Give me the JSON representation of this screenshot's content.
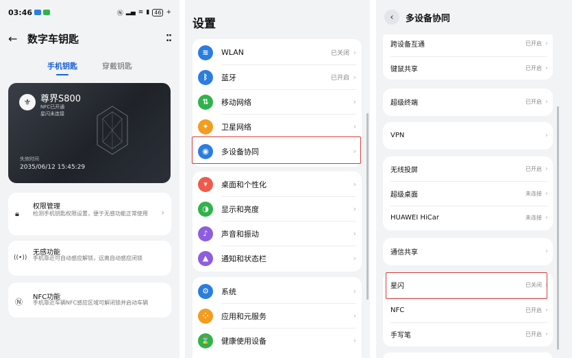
{
  "left": {
    "status": {
      "time": "03:46",
      "battery": "46"
    },
    "title": "数字车钥匙",
    "tabs": [
      "手机钥匙",
      "穿戴钥匙"
    ],
    "card": {
      "car_name": "尊界S800",
      "nfc_status": "NFC已开通",
      "star_status": "星闪未连接",
      "expiry_label": "失效时间",
      "expiry": "2035/06/12 15:45:29"
    },
    "features": [
      {
        "title": "权限管理",
        "desc": "检测手机钥匙权限设置，便于无感功能正常使用"
      },
      {
        "title": "无感功能",
        "desc": "手机靠近可自动感应解锁，远离自动感应闭锁"
      },
      {
        "title": "NFC功能",
        "desc": "手机靠近车辆NFC感应区域可解闭锁并启动车辆"
      }
    ]
  },
  "middle": {
    "title": "设置",
    "groups": [
      [
        {
          "label": "WLAN",
          "value": "已关闭",
          "icon": "wifi-icon",
          "color": "#2a7de1",
          "glyph": "≋"
        },
        {
          "label": "蓝牙",
          "value": "已开启",
          "icon": "bluetooth-icon",
          "color": "#2a7de1",
          "glyph": "ᛒ"
        },
        {
          "label": "移动网络",
          "value": "",
          "icon": "mobile-network-icon",
          "color": "#2fb34a",
          "glyph": "⇅"
        },
        {
          "label": "卫星网络",
          "value": "",
          "icon": "satellite-icon",
          "color": "#f39c1f",
          "glyph": "✦"
        },
        {
          "label": "多设备协同",
          "value": "",
          "icon": "multi-device-icon",
          "color": "#2a7de1",
          "glyph": "◉"
        }
      ],
      [
        {
          "label": "桌面和个性化",
          "value": "",
          "icon": "personalize-icon",
          "color": "#ef5a4a",
          "glyph": "▾"
        },
        {
          "label": "显示和亮度",
          "value": "",
          "icon": "display-icon",
          "color": "#2fb34a",
          "glyph": "◑"
        },
        {
          "label": "声音和振动",
          "value": "",
          "icon": "sound-icon",
          "color": "#8e5de0",
          "glyph": "♪"
        },
        {
          "label": "通知和状态栏",
          "value": "",
          "icon": "notification-icon",
          "color": "#8e5de0",
          "glyph": "▲"
        }
      ],
      [
        {
          "label": "系统",
          "value": "",
          "icon": "system-icon",
          "color": "#2a7de1",
          "glyph": "⚙"
        },
        {
          "label": "应用和元服务",
          "value": "",
          "icon": "apps-icon",
          "color": "#f39c1f",
          "glyph": "⁘"
        },
        {
          "label": "健康使用设备",
          "value": "",
          "icon": "hourglass-icon",
          "color": "#2fb34a",
          "glyph": "⌛"
        }
      ]
    ]
  },
  "right": {
    "title": "多设备协同",
    "groups": [
      [
        {
          "label": "跨设备互通",
          "value": "已开启"
        },
        {
          "label": "键鼠共享",
          "value": "已开启"
        }
      ],
      [
        {
          "label": "超级终端",
          "value": "已开启"
        }
      ],
      [
        {
          "label": "VPN",
          "value": ""
        }
      ],
      [
        {
          "label": "无线投屏",
          "value": "已开启"
        },
        {
          "label": "超级桌面",
          "value": "未连接"
        },
        {
          "label": "HUAWEI HiCar",
          "value": "未连接"
        }
      ],
      [
        {
          "label": "通信共享",
          "value": ""
        }
      ],
      [
        {
          "label": "星闪",
          "value": "已关闭"
        },
        {
          "label": "NFC",
          "value": "已开启"
        },
        {
          "label": "手写笔",
          "value": "已开启"
        }
      ]
    ]
  }
}
